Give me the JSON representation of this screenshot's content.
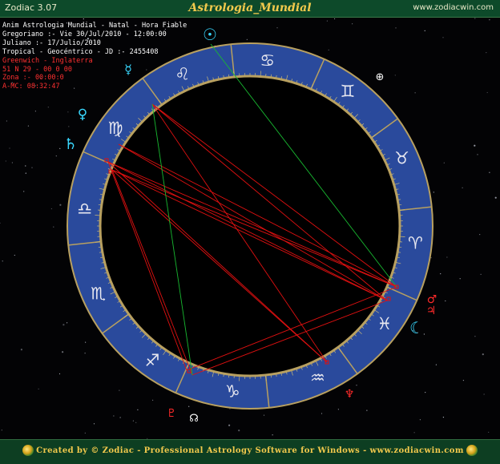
{
  "titlebar": {
    "app_title": "Zodiac 3.07",
    "window_title": "Astrologia_Mundial",
    "website": "www.zodiacwin.com"
  },
  "chart_info": {
    "line1": "Anim Astrologia Mundial - Natal - Hora Fiable",
    "line2": "Gregoriano :- Vie 30/Jul/2010 - 12:00:00",
    "line3": "Juliano :- 17/Julio/2010",
    "line4": "Tropical - Geocéntrico - JD :- 2455408",
    "line5": "Greenwich - Inglaterra",
    "line6": "51 N 29 - 00 0 00",
    "line7": "Zona :- 00:00:0",
    "line8": "A-MC: 08:32:47"
  },
  "colors": {
    "wheel_band": "#2a4a9c",
    "wheel_border": "#b8a060",
    "sign_glyph": "#e8e8f0",
    "aspect_red": "#e01010",
    "aspect_green": "#18b830",
    "planet_cyan": "#39d8ff",
    "planet_red": "#ff2a2a",
    "info_white": "#ffffff",
    "info_red": "#ff3030"
  },
  "zodiac_signs": [
    {
      "name": "aries-icon",
      "glyph": "♈"
    },
    {
      "name": "taurus-icon",
      "glyph": "♉"
    },
    {
      "name": "gemini-icon",
      "glyph": "♊"
    },
    {
      "name": "cancer-icon",
      "glyph": "♋"
    },
    {
      "name": "leo-icon",
      "glyph": "♌"
    },
    {
      "name": "virgo-icon",
      "glyph": "♍"
    },
    {
      "name": "libra-icon",
      "glyph": "♎"
    },
    {
      "name": "scorpio-icon",
      "glyph": "♏"
    },
    {
      "name": "sagittarius-icon",
      "glyph": "♐"
    },
    {
      "name": "capricorn-icon",
      "glyph": "♑"
    },
    {
      "name": "aquarius-icon",
      "glyph": "♒"
    },
    {
      "name": "pisces-icon",
      "glyph": "♓"
    }
  ],
  "planets": [
    {
      "name": "sun-icon",
      "glyph": "☉",
      "color": "#39d8ff"
    },
    {
      "name": "mercury-icon",
      "glyph": "☿",
      "color": "#39d8ff"
    },
    {
      "name": "venus-icon",
      "glyph": "♀",
      "color": "#39d8ff"
    },
    {
      "name": "saturn-icon",
      "glyph": "♄",
      "color": "#39d8ff"
    },
    {
      "name": "moon-icon",
      "glyph": "☾",
      "color": "#39d8ff"
    },
    {
      "name": "mars-icon",
      "glyph": "♂",
      "color": "#ff2a2a"
    },
    {
      "name": "jupiter-icon",
      "glyph": "♃",
      "color": "#ff2a2a"
    },
    {
      "name": "pluto-icon",
      "glyph": "♇",
      "color": "#ff2a2a"
    },
    {
      "name": "neptune-icon",
      "glyph": "♆",
      "color": "#ff2a2a"
    },
    {
      "name": "fortune-icon",
      "glyph": "⊕",
      "color": "#ffffff"
    },
    {
      "name": "node-icon",
      "glyph": "☊",
      "color": "#ffffff"
    }
  ],
  "footer": {
    "credits": "Created by © Zodiac - Professional Astrology Software for Windows - www.zodiacwin.com"
  }
}
